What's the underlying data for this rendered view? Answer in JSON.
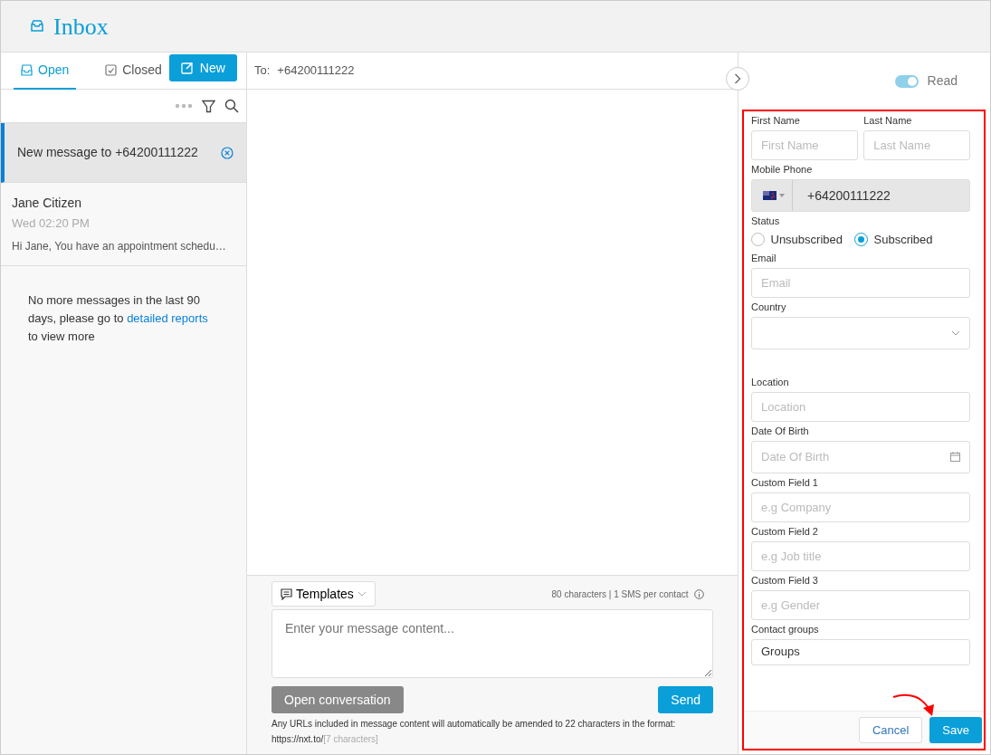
{
  "header": {
    "title": "Inbox"
  },
  "tabs": [
    {
      "label": "Open",
      "selected": true
    },
    {
      "label": "Closed",
      "selected": false
    }
  ],
  "new_button": "New",
  "conversations": [
    {
      "kind": "draft",
      "title": "New message to +64200111222",
      "selected": true
    },
    {
      "kind": "message",
      "title": "Jane Citizen",
      "time": "Wed 02:20 PM",
      "preview": "Hi Jane, You have an appointment schedu…",
      "selected": false
    }
  ],
  "empty_note": {
    "before": "No more messages in the last 90 days, please go to",
    "link": "detailed reports",
    "after": "to view more"
  },
  "to_field": {
    "label": "To:",
    "value": "+64200111222"
  },
  "compose": {
    "templates": "Templates",
    "counter": "80 characters | 1 SMS per contact",
    "placeholder": "Enter your message content...",
    "open_button": "Open conversation",
    "send_button": "Send",
    "note": "Any URLs included in message content will automatically be amended to 22 characters in the format: https://nxt.to/",
    "note_hint": "[7 characters]"
  },
  "read_toggle": {
    "label": "Read",
    "on": true
  },
  "contact_form": [
    {
      "kind": "pair",
      "fields": [
        {
          "label": "First Name",
          "placeholder": "First Name"
        },
        {
          "label": "Last Name",
          "placeholder": "Last Name"
        }
      ]
    },
    {
      "kind": "phone",
      "label": "Mobile Phone",
      "value": "+64200111222"
    },
    {
      "kind": "radio",
      "label": "Status",
      "options": [
        {
          "label": "Unsubscribed",
          "selected": false
        },
        {
          "label": "Subscribed",
          "selected": true
        }
      ]
    },
    {
      "kind": "text",
      "label": "Email",
      "placeholder": "Email"
    },
    {
      "kind": "select",
      "label": "Country"
    },
    {
      "kind": "text",
      "label": "Location",
      "placeholder": "Location"
    },
    {
      "kind": "date",
      "label": "Date Of Birth",
      "placeholder": "Date Of Birth"
    },
    {
      "kind": "text",
      "label": "Custom Field 1",
      "placeholder": "e.g Company"
    },
    {
      "kind": "text",
      "label": "Custom Field 2",
      "placeholder": "e.g Job title"
    },
    {
      "kind": "text",
      "label": "Custom Field 3",
      "placeholder": "e.g Gender"
    },
    {
      "kind": "groups",
      "label": "Contact groups",
      "value": "Groups"
    }
  ],
  "form_buttons": {
    "cancel": "Cancel",
    "save": "Save"
  }
}
